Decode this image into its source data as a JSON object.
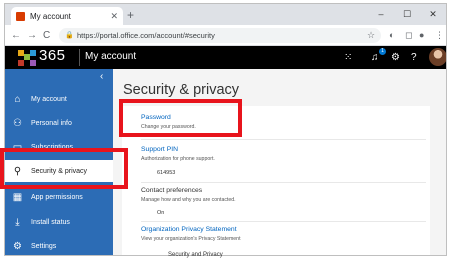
{
  "browser": {
    "tab_title": "My account",
    "tab_close": "✕",
    "new_tab": "+",
    "url": "https://portal.office.com/account/#security",
    "back": "←",
    "forward": "→",
    "reload": "C",
    "window_controls": [
      "–",
      "☐",
      "✕"
    ]
  },
  "header": {
    "brand_number": "365",
    "app_title": "My account",
    "notification_count": "1"
  },
  "sidebar": {
    "collapse": "‹",
    "items": [
      {
        "label": "My account",
        "icon": "home-icon"
      },
      {
        "label": "Personal info",
        "icon": "person-icon"
      },
      {
        "label": "Subscriptions",
        "icon": "card-icon"
      },
      {
        "label": "Security & privacy",
        "icon": "key-icon"
      },
      {
        "label": "App permissions",
        "icon": "grid-icon"
      },
      {
        "label": "Install status",
        "icon": "download-icon"
      },
      {
        "label": "Settings",
        "icon": "gear-icon"
      }
    ],
    "active_index": 3
  },
  "main": {
    "title": "Security & privacy",
    "sections": {
      "password": {
        "title": "Password",
        "subtitle": "Change your password."
      },
      "pin": {
        "title": "Support PIN",
        "subtitle": "Authorization for phone support.",
        "value": "614953"
      },
      "contact": {
        "title": "Contact preferences",
        "subtitle": "Manage how and why you are contacted.",
        "value": "On"
      },
      "org_privacy": {
        "title": "Organization Privacy Statement",
        "subtitle": "View your organization's Privacy Statement"
      }
    }
  },
  "footer_fragment": "Security and Privacy",
  "colors": {
    "sidebar": "#2c6cb5",
    "header": "#000000",
    "link": "#0064bf",
    "highlight": "#e8141c"
  }
}
